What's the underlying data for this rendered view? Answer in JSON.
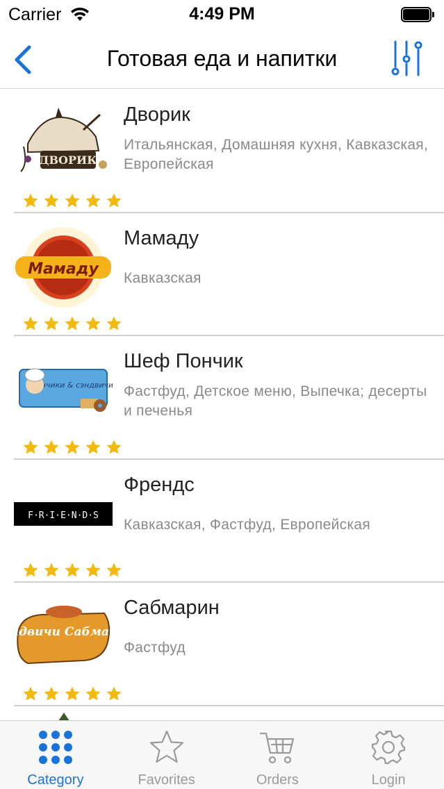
{
  "status_bar": {
    "carrier": "Carrier",
    "time": "4:49 PM"
  },
  "nav": {
    "title": "Готовая еда и напитки",
    "back_icon": "chevron-left-icon",
    "filter_icon": "sliders-icon",
    "accent_color": "#1a73d9"
  },
  "restaurants": [
    {
      "name": "Дворик",
      "cuisine": "Итальянская, Домашняя кухня, Кавказская, Европейская",
      "rating": 5,
      "logo_text": "ДВОРИК"
    },
    {
      "name": "Мамаду",
      "cuisine": "Кавказская",
      "rating": 5,
      "logo_text": "Мамаду"
    },
    {
      "name": "Шеф Пончик",
      "cuisine": "Фастфуд, Детское меню, Выпечка; десерты и печенья",
      "rating": 5,
      "logo_text": "пончики & сэндвичи"
    },
    {
      "name": "Френдс",
      "cuisine": "Кавказская, Фастфуд, Европейская",
      "rating": 5,
      "logo_text": "F·R·I·E·N·D·S"
    },
    {
      "name": "Сабмарин",
      "cuisine": "Фастфуд",
      "rating": 5,
      "logo_text": "Сендвичи Сабмарин"
    }
  ],
  "star_color": "#f2b90f",
  "tabs": [
    {
      "label": "Category",
      "icon": "grid-icon",
      "active": true
    },
    {
      "label": "Favorites",
      "icon": "star-icon",
      "active": false
    },
    {
      "label": "Orders",
      "icon": "cart-icon",
      "active": false
    },
    {
      "label": "Login",
      "icon": "gear-icon",
      "active": false
    }
  ]
}
